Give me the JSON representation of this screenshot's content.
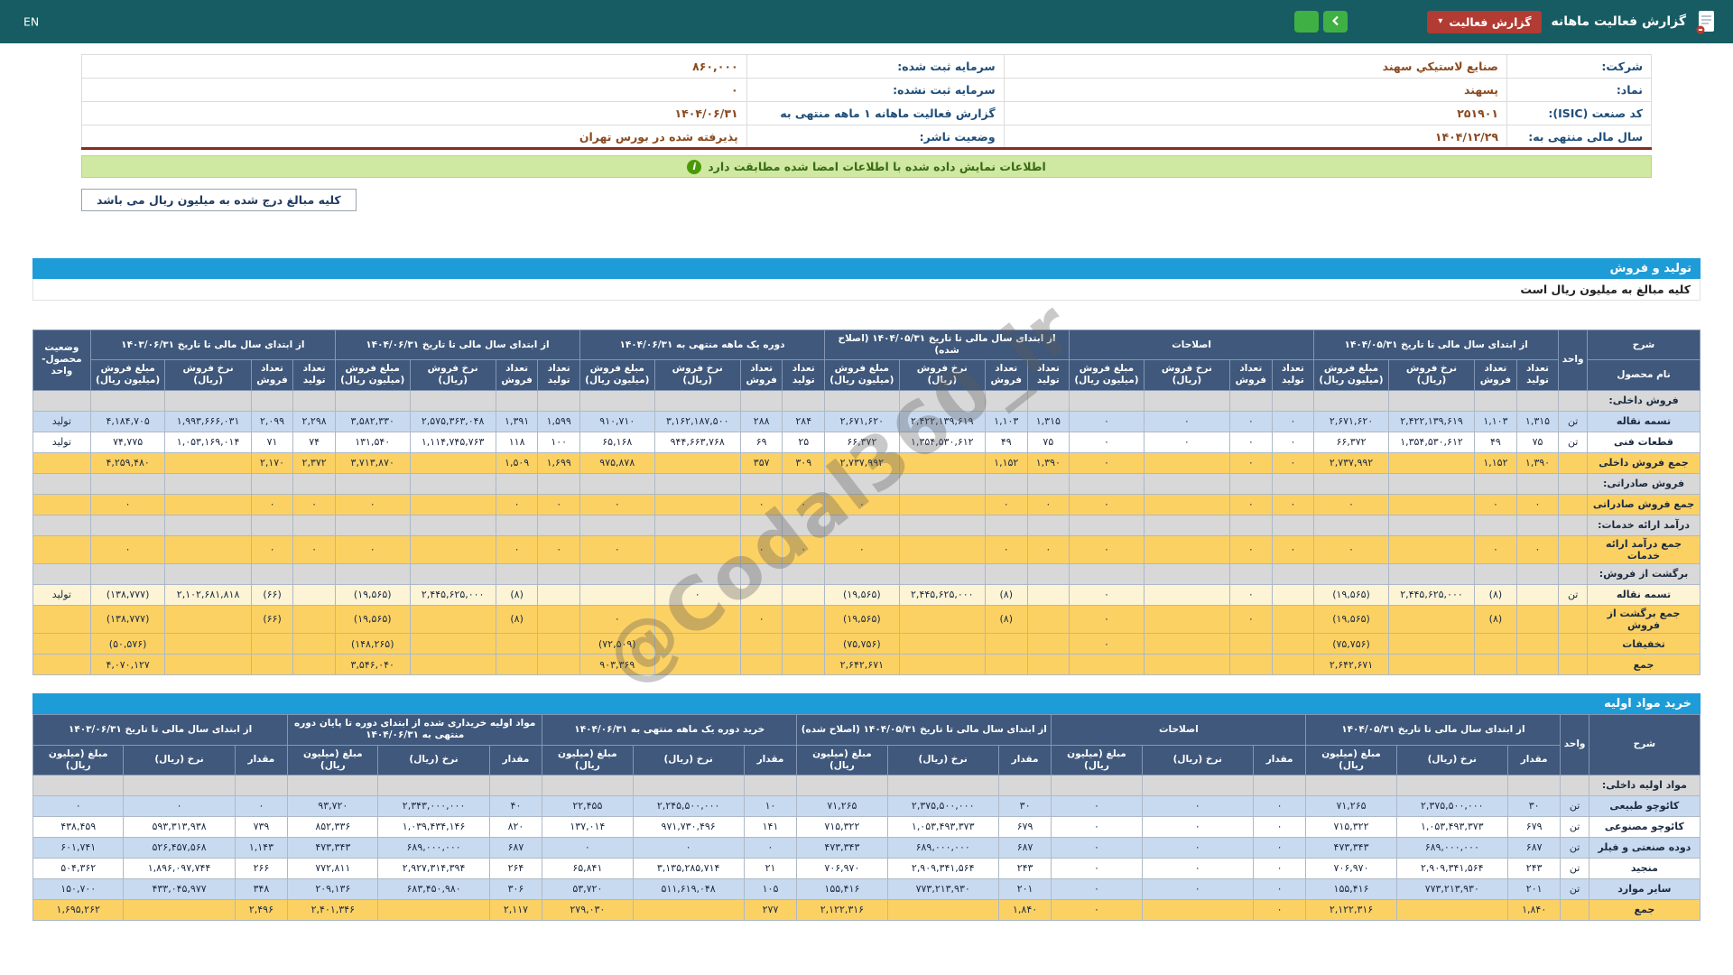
{
  "topbar": {
    "en": "EN",
    "title": "گزارش فعالیت ماهانه",
    "report_btn": "گزارش فعالیت"
  },
  "icons": {
    "caret": "▾",
    "info": "i"
  },
  "company_info": {
    "rows": [
      {
        "label_r": "شرکت:",
        "value_r": "صنايع لاستيکي سهند",
        "label_l": "سرمایه ثبت شده:",
        "value_l": "۸۶۰,۰۰۰"
      },
      {
        "label_r": "نماد:",
        "value_r": "پسهند",
        "label_l": "سرمایه ثبت نشده:",
        "value_l": "۰"
      },
      {
        "label_r": "کد صنعت (ISIC):",
        "value_r": "۲۵۱۹۰۱",
        "label_l": "گزارش فعالیت ماهانه ۱ ماهه منتهی به",
        "value_l": "۱۴۰۴/۰۶/۳۱"
      },
      {
        "label_r": "سال مالی منتهی به:",
        "value_r": "۱۴۰۴/۱۲/۲۹",
        "label_l": "وضعیت ناشر:",
        "value_l": "پذيرفته شده در بورس تهران"
      }
    ]
  },
  "notices": {
    "signed_info": "اطلاعات نمایش داده شده با اطلاعات امضا شده مطابقت دارد",
    "amounts_note": "کلیه مبالغ درج شده به میلیون ریال می باشد"
  },
  "watermark": "@Codal360_ir",
  "section1": {
    "title": "تولید و فروش",
    "subtitle": "کلیه مبالغ به میلیون ریال است",
    "table1": {
      "head_desc": "شرح",
      "head_name": "نام محصول",
      "head_unit": "واحد",
      "head_status": "وضعیت محصول-واحد",
      "groups": [
        {
          "label": "از ابتدای سال مالی تا تاریخ ۱۴۰۴/۰۵/۳۱"
        },
        {
          "label": "اصلاحات"
        },
        {
          "label": "از ابتدای سال مالی تا تاریخ ۱۴۰۴/۰۵/۳۱ (اصلاح شده)"
        },
        {
          "label": "دوره یک ماهه منتهی به ۱۴۰۴/۰۶/۳۱"
        },
        {
          "label": "از ابتدای سال مالی تا تاریخ ۱۴۰۴/۰۶/۳۱"
        },
        {
          "label": "از ابتدای سال مالی تا تاریخ ۱۴۰۳/۰۶/۳۱"
        }
      ],
      "sub_cols": [
        "تعداد تولید",
        "تعداد فروش",
        "نرخ فروش (ریال)",
        "مبلغ فروش (میلیون ریال)"
      ],
      "rows": [
        {
          "type": "group",
          "label": "فروش داخلی:"
        },
        {
          "type": "data",
          "cls": "blue",
          "name": "تسمه نقاله",
          "unit": "تن",
          "status": "تولید",
          "cells": [
            "۱,۳۱۵",
            "۱,۱۰۳",
            "۲,۴۲۲,۱۳۹,۶۱۹",
            "۲,۶۷۱,۶۲۰",
            "۰",
            "۰",
            "۰",
            "۰",
            "۱,۳۱۵",
            "۱,۱۰۳",
            "۲,۴۲۲,۱۳۹,۶۱۹",
            "۲,۶۷۱,۶۲۰",
            "۲۸۴",
            "۲۸۸",
            "۳,۱۶۲,۱۸۷,۵۰۰",
            "۹۱۰,۷۱۰",
            "۱,۵۹۹",
            "۱,۳۹۱",
            "۲,۵۷۵,۳۶۳,۰۴۸",
            "۳,۵۸۲,۳۳۰",
            "۲,۲۹۸",
            "۲,۰۹۹",
            "۱,۹۹۳,۶۶۶,۰۳۱",
            "۴,۱۸۴,۷۰۵"
          ]
        },
        {
          "type": "data",
          "cls": "white",
          "name": "قطعات فنی",
          "unit": "تن",
          "status": "تولید",
          "cells": [
            "۷۵",
            "۴۹",
            "۱,۳۵۴,۵۳۰,۶۱۲",
            "۶۶,۳۷۲",
            "۰",
            "۰",
            "۰",
            "۰",
            "۷۵",
            "۴۹",
            "۱,۳۵۴,۵۳۰,۶۱۲",
            "۶۶,۳۷۲",
            "۲۵",
            "۶۹",
            "۹۴۴,۶۶۳,۷۶۸",
            "۶۵,۱۶۸",
            "۱۰۰",
            "۱۱۸",
            "۱,۱۱۴,۷۴۵,۷۶۳",
            "۱۳۱,۵۴۰",
            "۷۴",
            "۷۱",
            "۱,۰۵۳,۱۶۹,۰۱۴",
            "۷۴,۷۷۵"
          ]
        },
        {
          "type": "data",
          "cls": "orange",
          "name": "جمع فروش داخلی",
          "unit": "",
          "status": "",
          "cells": [
            "۱,۳۹۰",
            "۱,۱۵۲",
            "",
            "۲,۷۳۷,۹۹۲",
            "۰",
            "۰",
            "",
            "۰",
            "۱,۳۹۰",
            "۱,۱۵۲",
            "",
            "۲,۷۳۷,۹۹۲",
            "۳۰۹",
            "۳۵۷",
            "",
            "۹۷۵,۸۷۸",
            "۱,۶۹۹",
            "۱,۵۰۹",
            "",
            "۳,۷۱۳,۸۷۰",
            "۲,۳۷۲",
            "۲,۱۷۰",
            "",
            "۴,۲۵۹,۴۸۰"
          ]
        },
        {
          "type": "group",
          "label": "فروش صادراتی:"
        },
        {
          "type": "data",
          "cls": "orange",
          "name": "جمع فروش صادراتی",
          "unit": "",
          "status": "",
          "cells": [
            "۰",
            "۰",
            "",
            "۰",
            "۰",
            "۰",
            "",
            "۰",
            "۰",
            "۰",
            "",
            "۰",
            "۰",
            "۰",
            "",
            "۰",
            "۰",
            "۰",
            "",
            "۰",
            "۰",
            "۰",
            "",
            "۰"
          ]
        },
        {
          "type": "group",
          "label": "درآمد ارائه خدمات:"
        },
        {
          "type": "data",
          "cls": "orange",
          "name": "جمع درآمد ارائه خدمات",
          "unit": "",
          "status": "",
          "cells": [
            "۰",
            "۰",
            "",
            "۰",
            "۰",
            "۰",
            "",
            "۰",
            "۰",
            "۰",
            "",
            "۰",
            "۰",
            "۰",
            "",
            "۰",
            "۰",
            "۰",
            "",
            "۰",
            "۰",
            "۰",
            "",
            "۰"
          ]
        },
        {
          "type": "group",
          "label": "برگشت از فروش:"
        },
        {
          "type": "data",
          "cls": "cream",
          "name": "تسمه نقاله",
          "unit": "تن",
          "status": "تولید",
          "cells": [
            "",
            "(۸)",
            "۲,۴۴۵,۶۲۵,۰۰۰",
            "(۱۹,۵۶۵)",
            "",
            "۰",
            "",
            "۰",
            "",
            "(۸)",
            "۲,۴۴۵,۶۲۵,۰۰۰",
            "(۱۹,۵۶۵)",
            "",
            "",
            "۰",
            "",
            "",
            "(۸)",
            "۲,۴۴۵,۶۲۵,۰۰۰",
            "(۱۹,۵۶۵)",
            "",
            "(۶۶)",
            "۲,۱۰۲,۶۸۱,۸۱۸",
            "(۱۳۸,۷۷۷)"
          ]
        },
        {
          "type": "data",
          "cls": "orange",
          "name": "جمع برگشت از فروش",
          "unit": "",
          "status": "",
          "cells": [
            "",
            "(۸)",
            "",
            "(۱۹,۵۶۵)",
            "",
            "۰",
            "",
            "۰",
            "",
            "(۸)",
            "",
            "(۱۹,۵۶۵)",
            "",
            "۰",
            "",
            "۰",
            "",
            "(۸)",
            "",
            "(۱۹,۵۶۵)",
            "",
            "(۶۶)",
            "",
            "(۱۳۸,۷۷۷)"
          ]
        },
        {
          "type": "data",
          "cls": "orange",
          "name": "تخفیفات",
          "unit": "",
          "status": "",
          "cells": [
            "",
            "",
            "",
            "(۷۵,۷۵۶)",
            "",
            "",
            "",
            "۰",
            "",
            "",
            "",
            "(۷۵,۷۵۶)",
            "",
            "",
            "",
            "(۷۲,۵۰۹)",
            "",
            "",
            "",
            "(۱۴۸,۲۶۵)",
            "",
            "",
            "",
            "(۵۰,۵۷۶)"
          ]
        },
        {
          "type": "data",
          "cls": "orange",
          "name": "جمع",
          "unit": "",
          "status": "",
          "cells": [
            "",
            "",
            "",
            "۲,۶۴۲,۶۷۱",
            "",
            "",
            "",
            "",
            "",
            "",
            "",
            "۲,۶۴۲,۶۷۱",
            "",
            "",
            "",
            "۹۰۳,۳۶۹",
            "",
            "",
            "",
            "۳,۵۴۶,۰۴۰",
            "",
            "",
            "",
            "۴,۰۷۰,۱۲۷"
          ]
        }
      ]
    }
  },
  "section2": {
    "title": "خرید مواد اولیه",
    "table2": {
      "head_desc": "شرح",
      "head_unit": "واحد",
      "groups": [
        {
          "label": "از ابتدای سال مالی تا تاریخ ۱۴۰۴/۰۵/۳۱"
        },
        {
          "label": "اصلاحات"
        },
        {
          "label": "از ابتدای سال مالی تا تاریخ ۱۴۰۴/۰۵/۳۱ (اصلاح شده)"
        },
        {
          "label": "خرید دوره یک ماهه منتهی به ۱۴۰۴/۰۶/۳۱"
        },
        {
          "label": "مواد اولیه خریداری شده از ابتدای دوره تا پایان دوره منتهی به ۱۴۰۴/۰۶/۳۱"
        },
        {
          "label": "از ابتدای سال مالی تا تاریخ ۱۴۰۳/۰۶/۳۱"
        }
      ],
      "sub_cols": [
        "مقدار",
        "نرخ (ریال)",
        "مبلغ (میلیون ریال)"
      ],
      "rows": [
        {
          "type": "group",
          "label": "مواد اولیه داخلی:"
        },
        {
          "type": "data",
          "cls": "blue",
          "name": "کائوچو طبیعی",
          "unit": "تن",
          "cells": [
            "۳۰",
            "۲,۳۷۵,۵۰۰,۰۰۰",
            "۷۱,۲۶۵",
            "۰",
            "۰",
            "۰",
            "۳۰",
            "۲,۳۷۵,۵۰۰,۰۰۰",
            "۷۱,۲۶۵",
            "۱۰",
            "۲,۲۴۵,۵۰۰,۰۰۰",
            "۲۲,۴۵۵",
            "۴۰",
            "۲,۳۴۳,۰۰۰,۰۰۰",
            "۹۳,۷۲۰",
            "۰",
            "۰",
            "۰"
          ]
        },
        {
          "type": "data",
          "cls": "white",
          "name": "کائوچو مصنوعی",
          "unit": "تن",
          "cells": [
            "۶۷۹",
            "۱,۰۵۳,۴۹۳,۳۷۳",
            "۷۱۵,۳۲۲",
            "۰",
            "۰",
            "۰",
            "۶۷۹",
            "۱,۰۵۳,۴۹۳,۳۷۳",
            "۷۱۵,۳۲۲",
            "۱۴۱",
            "۹۷۱,۷۳۰,۴۹۶",
            "۱۳۷,۰۱۴",
            "۸۲۰",
            "۱,۰۳۹,۴۳۴,۱۴۶",
            "۸۵۲,۳۳۶",
            "۷۳۹",
            "۵۹۳,۳۱۳,۹۳۸",
            "۴۳۸,۴۵۹"
          ]
        },
        {
          "type": "data",
          "cls": "blue",
          "name": "دوده صنعتی و فیلر",
          "unit": "تن",
          "cells": [
            "۶۸۷",
            "۶۸۹,۰۰۰,۰۰۰",
            "۴۷۳,۳۴۳",
            "۰",
            "۰",
            "۰",
            "۶۸۷",
            "۶۸۹,۰۰۰,۰۰۰",
            "۴۷۳,۳۴۳",
            "۰",
            "۰",
            "۰",
            "۶۸۷",
            "۶۸۹,۰۰۰,۰۰۰",
            "۴۷۳,۳۴۳",
            "۱,۱۴۳",
            "۵۲۶,۴۵۷,۵۶۸",
            "۶۰۱,۷۴۱"
          ]
        },
        {
          "type": "data",
          "cls": "white",
          "name": "منجید",
          "unit": "تن",
          "cells": [
            "۲۴۳",
            "۲,۹۰۹,۳۴۱,۵۶۴",
            "۷۰۶,۹۷۰",
            "۰",
            "۰",
            "۰",
            "۲۴۳",
            "۲,۹۰۹,۳۴۱,۵۶۴",
            "۷۰۶,۹۷۰",
            "۲۱",
            "۳,۱۳۵,۲۸۵,۷۱۴",
            "۶۵,۸۴۱",
            "۲۶۴",
            "۲,۹۲۷,۳۱۴,۳۹۴",
            "۷۷۲,۸۱۱",
            "۲۶۶",
            "۱,۸۹۶,۰۹۷,۷۴۴",
            "۵۰۴,۳۶۲"
          ]
        },
        {
          "type": "data",
          "cls": "blue",
          "name": "سایر موارد",
          "unit": "تن",
          "cells": [
            "۲۰۱",
            "۷۷۳,۲۱۳,۹۳۰",
            "۱۵۵,۴۱۶",
            "۰",
            "۰",
            "۰",
            "۲۰۱",
            "۷۷۳,۲۱۳,۹۳۰",
            "۱۵۵,۴۱۶",
            "۱۰۵",
            "۵۱۱,۶۱۹,۰۴۸",
            "۵۳,۷۲۰",
            "۳۰۶",
            "۶۸۳,۴۵۰,۹۸۰",
            "۲۰۹,۱۳۶",
            "۳۴۸",
            "۴۳۳,۰۴۵,۹۷۷",
            "۱۵۰,۷۰۰"
          ]
        },
        {
          "type": "data",
          "cls": "orange",
          "name": "جمع",
          "unit": "",
          "cells": [
            "۱,۸۴۰",
            "",
            "۲,۱۲۲,۳۱۶",
            "۰",
            "",
            "۰",
            "۱,۸۴۰",
            "",
            "۲,۱۲۲,۳۱۶",
            "۲۷۷",
            "",
            "۲۷۹,۰۳۰",
            "۲,۱۱۷",
            "",
            "۲,۴۰۱,۳۴۶",
            "۲,۴۹۶",
            "",
            "۱,۶۹۵,۲۶۲"
          ]
        }
      ]
    }
  }
}
